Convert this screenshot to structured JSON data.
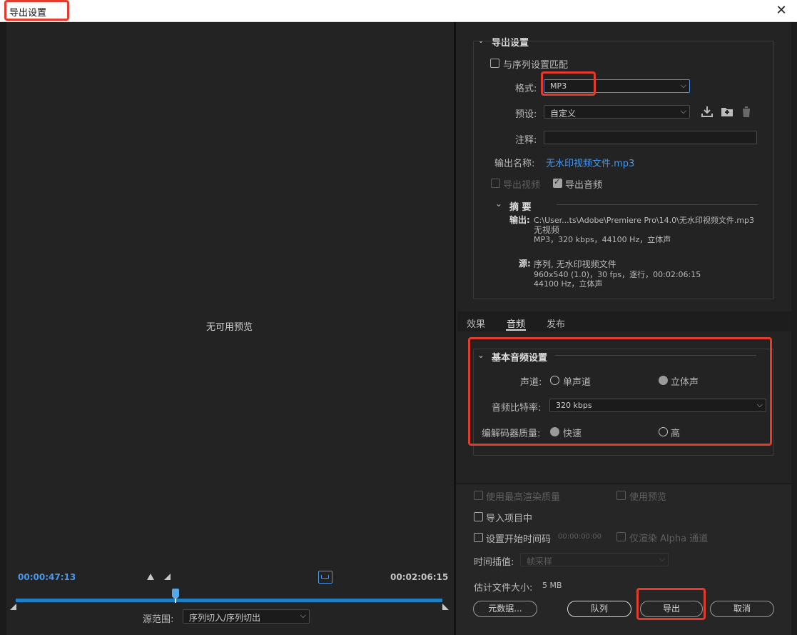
{
  "title": "导出设置",
  "close_glyph": "✕",
  "preview": {
    "no_preview": "无可用预览",
    "time_start": "00:00:47:13",
    "time_end": "00:02:06:15",
    "source_range_label": "源范围:",
    "source_range_value": "序列切入/序列切出",
    "playhead_position": 0.37
  },
  "export_settings": {
    "header": "导出设置",
    "match_sequence": "与序列设置匹配",
    "format_label": "格式:",
    "format_value": "MP3",
    "preset_label": "预设:",
    "preset_value": "自定义",
    "comments_label": "注释:",
    "comments_value": "",
    "output_name_label": "输出名称:",
    "output_name_value": "无水印视频文件.mp3",
    "export_video": "导出视频",
    "export_audio": "导出音频",
    "export_video_checked": false,
    "export_audio_checked": true
  },
  "summary": {
    "header": "摘 要",
    "output_label": "输出:",
    "output_line1": "C:\\User...ts\\Adobe\\Premiere  Pro\\14.0\\无水印视频文件.mp3",
    "output_line2": "无视频",
    "output_line3": "MP3，320 kbps，44100 Hz，立体声",
    "source_label": "源:",
    "source_line1": "序列, 无水印视频文件",
    "source_line2": "960x540  (1.0)，30 fps，逐行，00:02:06:15",
    "source_line3": "44100 Hz，立体声"
  },
  "tabs": [
    "效果",
    "音频",
    "发布"
  ],
  "active_tab": "音频",
  "audio": {
    "header": "基本音频设置",
    "channels_label": "声道:",
    "mono": "单声道",
    "stereo": "立体声",
    "channels_selected": "立体声",
    "bitrate_label": "音频比特率:",
    "bitrate_value": "320 kbps",
    "codec_quality_label": "编解码器质量:",
    "fast": "快速",
    "high": "高",
    "quality_selected": "快速"
  },
  "bottom": {
    "max_render": "使用最高渲染质量",
    "use_previews": "使用预览",
    "import_project": "导入项目中",
    "set_start_tc": "设置开始时间码",
    "start_tc_value": "00:00:00:00",
    "render_alpha": "仅渲染 Alpha 通道",
    "time_interp_label": "时间插值:",
    "time_interp_value": "帧采样",
    "est_size_label": "估计文件大小:",
    "est_size_value": "5 MB",
    "metadata_btn": "元数据...",
    "queue_btn": "队列",
    "export_btn": "导出",
    "cancel_btn": "取消"
  },
  "colors": {
    "accent_blue": "#4b96e8",
    "highlight_red": "#e53b2c",
    "timeline_blue": "#1d7fc4"
  }
}
